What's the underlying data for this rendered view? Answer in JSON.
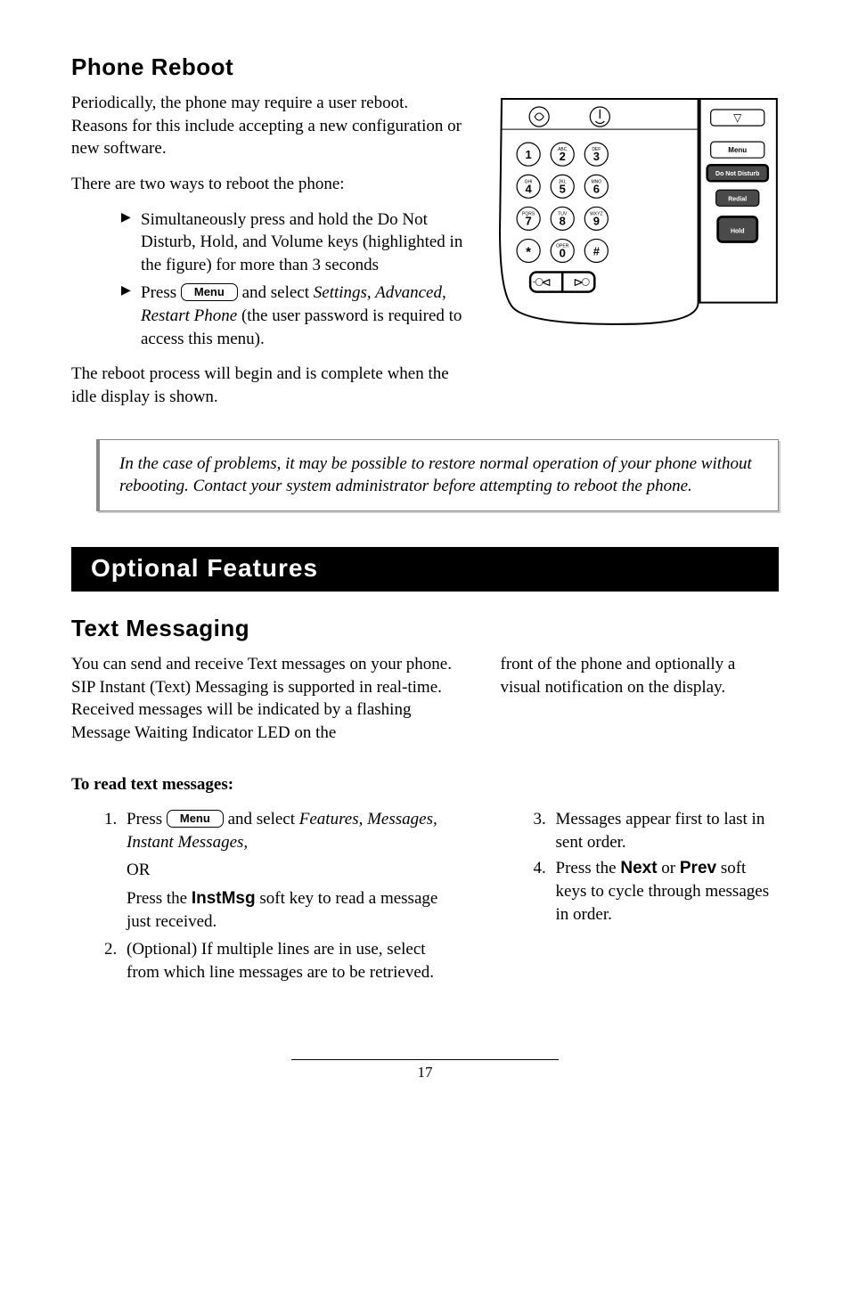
{
  "section1": {
    "heading": "Phone Reboot",
    "p1": "Periodically, the phone may require a user reboot.  Reasons for this include accepting a new configuration or new software.",
    "p2": "There are two ways to reboot the phone:",
    "bullet1": "Simultaneously press and hold the Do Not Disturb, Hold, and Volume keys (highlighted in the figure) for more than 3 seconds",
    "bullet2_pre": "Press ",
    "bullet2_key": "Menu",
    "bullet2_post_a": " and select ",
    "bullet2_post_em": "Settings, Advanced, Restart Phone",
    "bullet2_post_b": " (the user password is required to access this menu).",
    "p3": "The reboot process will begin and is complete when the idle display is shown.",
    "note": "In the case of problems, it may be possible to restore normal operation of your phone without rebooting.  Contact your system administrator before attempting to reboot the phone."
  },
  "keypad": {
    "keys": [
      {
        "n": "1",
        "sup": ""
      },
      {
        "n": "2",
        "sup": "ABC"
      },
      {
        "n": "3",
        "sup": "DEF"
      },
      {
        "n": "4",
        "sup": "GHI"
      },
      {
        "n": "5",
        "sup": "JKL"
      },
      {
        "n": "6",
        "sup": "MNO"
      },
      {
        "n": "7",
        "sup": "PQRS"
      },
      {
        "n": "8",
        "sup": "TUV"
      },
      {
        "n": "9",
        "sup": "WXYZ"
      },
      {
        "n": "*",
        "sup": ""
      },
      {
        "n": "0",
        "sup": "OPER"
      },
      {
        "n": "#",
        "sup": ""
      }
    ],
    "side_buttons": {
      "menu": "Menu",
      "dnd": "Do Not Disturb",
      "redial": "Redial",
      "hold": "Hold"
    }
  },
  "bar": {
    "title": "Optional Features"
  },
  "section2": {
    "heading": "Text Messaging",
    "left_p": "You can send and receive Text messages on your phone.  SIP Instant (Text) Messaging is supported in real-time.  Received messages will be indicated by a flashing Message Waiting Indicator LED on the",
    "right_p": "front of the phone and optionally a visual notification on the display.",
    "read_heading": "To read text messages:",
    "n1_pre": "Press ",
    "n1_key": "Menu",
    "n1_post_a": " and select ",
    "n1_post_em": "Features, Messages, Instant Messages,",
    "n1_or": "OR",
    "n1_sub_a": "Press the ",
    "n1_sub_key": "InstMsg",
    "n1_sub_b": " soft key to read a message just received.",
    "n2": "(Optional)  If multiple lines are in use, select from which line messages are to be retrieved.",
    "n3": "Messages appear first to last in sent order.",
    "n4_a": "Press the ",
    "n4_next": "Next",
    "n4_b": " or ",
    "n4_prev": "Prev",
    "n4_c": " soft keys to cycle through messages in order."
  },
  "footer": {
    "page": "17"
  }
}
